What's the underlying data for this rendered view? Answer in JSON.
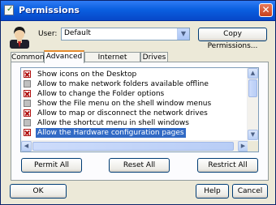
{
  "window": {
    "title": "Permissions",
    "close_glyph": "✕"
  },
  "user": {
    "label": "User:",
    "value": "Default"
  },
  "buttons": {
    "copy_permissions": "Copy Permissions...",
    "permit_all": "Permit All",
    "reset_all": "Reset All",
    "restrict_all": "Restrict All",
    "ok": "OK",
    "help": "Help",
    "cancel": "Cancel"
  },
  "tabs": [
    {
      "label": "Common",
      "active": false
    },
    {
      "label": "Advanced",
      "active": true
    },
    {
      "label": "Internet Explorer",
      "active": false
    },
    {
      "label": "Drives",
      "active": false
    }
  ],
  "permissions": [
    {
      "label": "Show icons on the Desktop",
      "state": "denied"
    },
    {
      "label": "Allow to make network folders available offline",
      "state": "neutral"
    },
    {
      "label": "Allow to change the Folder options",
      "state": "denied"
    },
    {
      "label": "Show the File menu on the shell window menus",
      "state": "neutral"
    },
    {
      "label": "Allow to map or disconnect the network drives",
      "state": "denied"
    },
    {
      "label": "Allow the shortcut menu in shell windows",
      "state": "neutral"
    },
    {
      "label": "Allow the Hardware configuration pages",
      "state": "denied",
      "selected": true
    }
  ],
  "icons": {
    "title": "check-document-icon",
    "avatar": "user-silhouette-icon",
    "combo_arrow": "chevron-down-icon",
    "scroll_up": "arrow-up-icon",
    "scroll_down": "arrow-down-icon",
    "scroll_left": "arrow-left-icon",
    "scroll_right": "arrow-right-icon"
  },
  "colors": {
    "title_bar": "#0a5fe0",
    "dialog_bg": "#ece9d8",
    "selection": "#316ac5",
    "deny_mark": "#b01010",
    "active_tab_accent": "#e68b2c"
  }
}
